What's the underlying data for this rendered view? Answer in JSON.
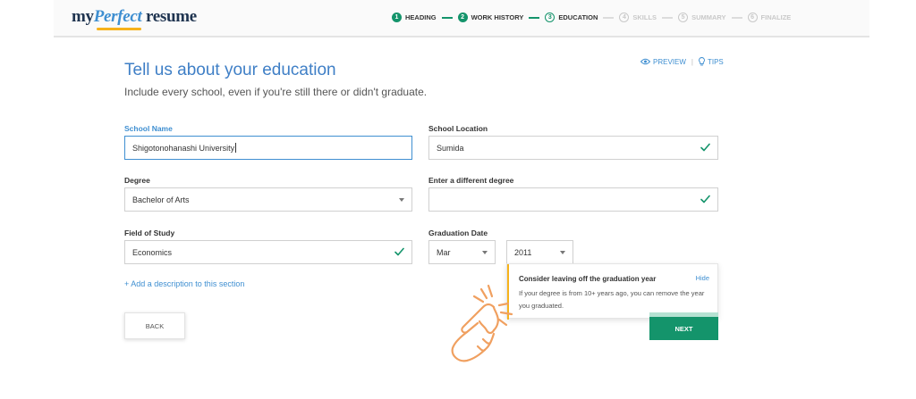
{
  "brand": {
    "my": "my",
    "perfect": "Perfect",
    "resume": "resume"
  },
  "steps": [
    {
      "num": "1",
      "label": "HEADING",
      "state": "done"
    },
    {
      "num": "2",
      "label": "WORK HISTORY",
      "state": "done"
    },
    {
      "num": "3",
      "label": "EDUCATION",
      "state": "current"
    },
    {
      "num": "4",
      "label": "SKILLS",
      "state": "todo"
    },
    {
      "num": "5",
      "label": "SUMMARY",
      "state": "todo"
    },
    {
      "num": "6",
      "label": "FINALIZE",
      "state": "todo"
    }
  ],
  "header": {
    "title": "Tell us about your education",
    "subtitle": "Include every school, even if you're still there or didn't graduate.",
    "preview": "PREVIEW",
    "separator": "|",
    "tips": "TIPS"
  },
  "form": {
    "school_name": {
      "label": "School Name",
      "value": "Shigotonohanashi University"
    },
    "school_location": {
      "label": "School Location",
      "value": "Sumida"
    },
    "degree": {
      "label": "Degree",
      "value": "Bachelor of Arts"
    },
    "different_degree": {
      "label": "Enter a different degree",
      "value": ""
    },
    "field_of_study": {
      "label": "Field of Study",
      "value": "Economics"
    },
    "graduation": {
      "label": "Graduation Date",
      "month": "Mar",
      "year": "2011"
    }
  },
  "add_description": "+ Add a description to this section",
  "buttons": {
    "back": "BACK",
    "next": "NEXT"
  },
  "tip": {
    "title": "Consider leaving off the graduation year",
    "hide": "Hide",
    "body": "If your degree is from 10+ years ago, you can remove the year you graduated."
  },
  "colors": {
    "accent": "#3f8fd1",
    "success": "#14946b",
    "highlight": "#f6b21b",
    "hand": "#f0a060"
  }
}
